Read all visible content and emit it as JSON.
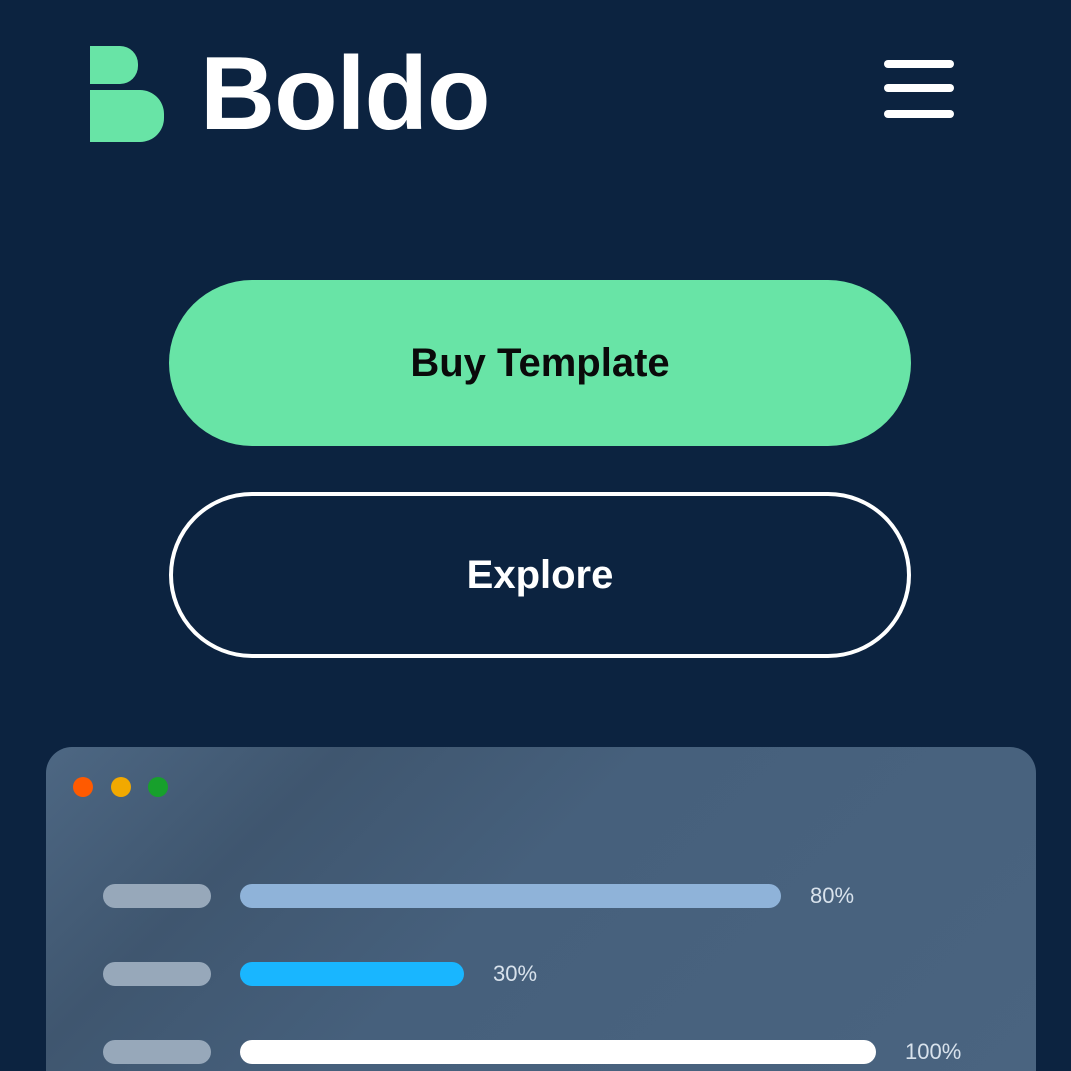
{
  "header": {
    "logo_text": "Boldo",
    "menu_icon": "hamburger-menu-icon"
  },
  "cta": {
    "primary_label": "Buy Template",
    "secondary_label": "Explore"
  },
  "colors": {
    "background": "#0c2340",
    "brand_green": "#68e4a6",
    "bar_1": "#8fb3d9",
    "bar_2": "#19b6ff",
    "bar_3": "#ffffff"
  },
  "dashboard": {
    "window_dots": [
      "red",
      "yellow",
      "green"
    ],
    "bars": [
      {
        "value": 80,
        "label": "80%"
      },
      {
        "value": 30,
        "label": "30%"
      },
      {
        "value": 100,
        "label": "100%"
      }
    ]
  }
}
